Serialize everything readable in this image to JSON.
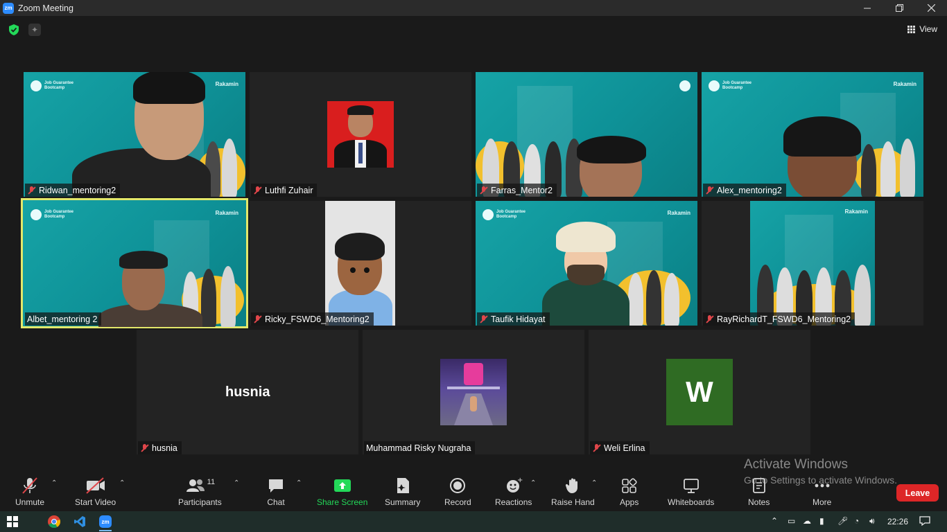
{
  "window": {
    "title": "Zoom Meeting",
    "app_icon": "zm"
  },
  "top": {
    "view_label": "View"
  },
  "tiles": [
    {
      "name": "Ridwan_mentoring2",
      "muted": true
    },
    {
      "name": "Luthfi Zuhair",
      "muted": true
    },
    {
      "name": "Farras_Mentor2",
      "muted": true
    },
    {
      "name": "Alex_mentoring2",
      "muted": true
    },
    {
      "name": "Albet_mentoring 2",
      "muted": false
    },
    {
      "name": "Ricky_FSWD6_Mentoring2",
      "muted": true
    },
    {
      "name": "Taufik Hidayat",
      "muted": true
    },
    {
      "name": "RayRichardT_FSWD6_Mentoring2",
      "muted": true
    },
    {
      "name": "husnia",
      "muted": true,
      "display": "husnia"
    },
    {
      "name": "Muhammad Risky Nugraha",
      "muted": false
    },
    {
      "name": "Weli Erlina",
      "muted": true,
      "initial": "W"
    }
  ],
  "background": {
    "title": "Job Guarantee\nBootcamp",
    "brand": "Rakamin",
    "brand_sub": "Academy"
  },
  "watermark": {
    "line1": "Activate Windows",
    "line2": "Go to Settings to activate Windows."
  },
  "toolbar": {
    "unmute": "Unmute",
    "start_video": "Start Video",
    "participants": "Participants",
    "participants_count": "11",
    "chat": "Chat",
    "share_screen": "Share Screen",
    "summary": "Summary",
    "record": "Record",
    "reactions": "Reactions",
    "raise_hand": "Raise Hand",
    "apps": "Apps",
    "whiteboards": "Whiteboards",
    "notes": "Notes",
    "more": "More",
    "leave": "Leave"
  },
  "taskbar": {
    "time": "22:26"
  },
  "colors": {
    "accent_green": "#23d959",
    "leave_red": "#dd2627",
    "active_border": "#e3e86a",
    "teal_bg": "#0e9197"
  }
}
